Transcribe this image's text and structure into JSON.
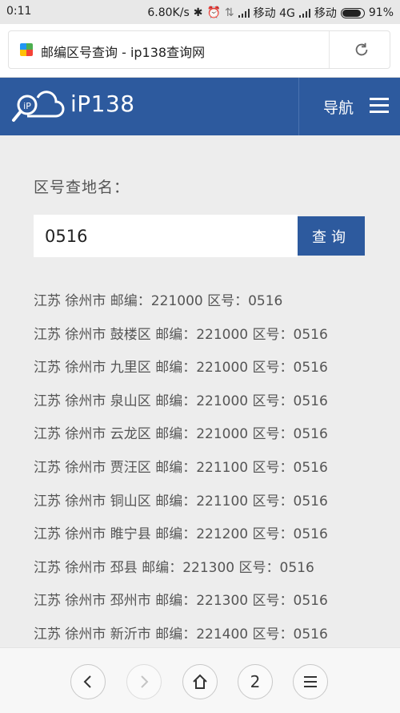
{
  "status_bar": {
    "time": "0:11",
    "speed": "6.80K/s",
    "carrier1": "移动 4G",
    "carrier2": "移动",
    "battery": "91%"
  },
  "browser": {
    "page_title": "邮编区号查询 - ip138查询网"
  },
  "header": {
    "brand": "iP138",
    "nav_label": "导航"
  },
  "search": {
    "label": "区号查地名：",
    "value": "0516",
    "button_label": "查询"
  },
  "results": [
    "江苏 徐州市 邮编：221000 区号：0516",
    "江苏 徐州市 鼓楼区 邮编：221000 区号：0516",
    "江苏 徐州市 九里区 邮编：221000 区号：0516",
    "江苏 徐州市 泉山区 邮编：221000 区号：0516",
    "江苏 徐州市 云龙区 邮编：221000 区号：0516",
    "江苏 徐州市 贾汪区 邮编：221100 区号：0516",
    "江苏 徐州市 铜山区 邮编：221100 区号：0516",
    "江苏 徐州市 睢宁县 邮编：221200 区号：0516",
    "江苏 徐州市 邳县 邮编：221300 区号：0516",
    "江苏 徐州市 邳州市 邮编：221300 区号：0516",
    "江苏 徐州市 新沂市 邮编：221400 区号：0516"
  ],
  "bottom_bar": {
    "tab_count": "2"
  },
  "colors": {
    "header_bg": "#2d5a9e",
    "button_bg": "#2d5a9e",
    "page_bg": "#ededed"
  }
}
